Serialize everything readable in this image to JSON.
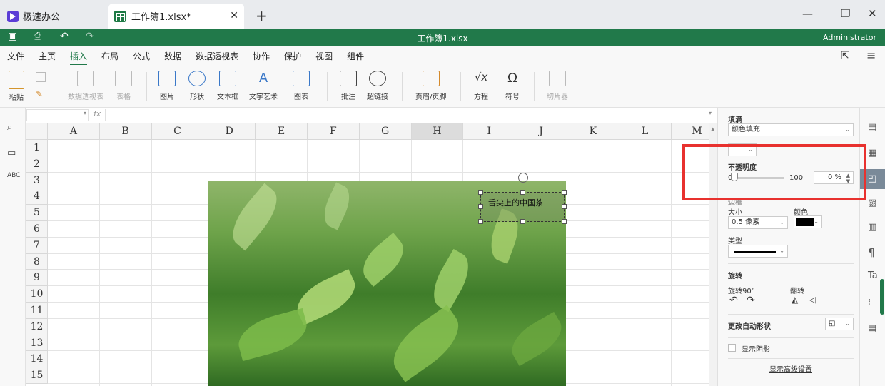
{
  "tabs": {
    "app_label": "极速办公",
    "doc_label": "工作簿1.xlsx*"
  },
  "titlebar": {
    "filename": "工作簿1.xlsx",
    "user": "Administrator"
  },
  "menu": [
    "文件",
    "主页",
    "插入",
    "布局",
    "公式",
    "数据",
    "数据透视表",
    "协作",
    "保护",
    "视图",
    "组件"
  ],
  "menu_active_index": 2,
  "ribbon": {
    "paste": "粘贴",
    "pivot": "数据透视表",
    "table": "表格",
    "picture": "图片",
    "shape": "形状",
    "textbox": "文本框",
    "wordart": "文字艺术",
    "chart": "图表",
    "comment": "批注",
    "hyperlink": "超链接",
    "headerfooter": "页眉/页脚",
    "equation": "方程",
    "symbol": "符号",
    "slicer": "切片器"
  },
  "formula_bar": {
    "fx": "fx"
  },
  "grid": {
    "columns": [
      "A",
      "B",
      "C",
      "D",
      "E",
      "F",
      "G",
      "H",
      "I",
      "J",
      "K",
      "L",
      "M"
    ],
    "selected_column": "H",
    "rows": [
      "1",
      "2",
      "3",
      "4",
      "5",
      "6",
      "7",
      "8",
      "9",
      "10",
      "11",
      "12",
      "13",
      "14",
      "15"
    ]
  },
  "textbox_text": "舌尖上的中国茶",
  "panel": {
    "fill_title": "填满",
    "fill_value": "颜色填充",
    "opacity_title": "不透明度",
    "opacity_min": "0",
    "opacity_max": "100",
    "opacity_value": "0 %",
    "opacity_level": 0,
    "line_title": "边框",
    "size_label": "大小",
    "size_value": "0.5 像素",
    "color_label": "颜色",
    "type_label": "类型",
    "rotation_title": "旋转",
    "rotate90_label": "旋转90°",
    "flip_label": "翻转",
    "autoshape_label": "更改自动形状",
    "shadow_label": "显示阴影",
    "advanced_link": "显示高级设置"
  },
  "colors": {
    "brand": "#21794a",
    "highlight": "#e8312e"
  },
  "icons": [
    "search-icon",
    "comment-icon",
    "spellcheck-icon",
    "rotate-left-icon",
    "rotate-right-icon",
    "flip-horizontal-icon",
    "flip-vertical-icon"
  ]
}
